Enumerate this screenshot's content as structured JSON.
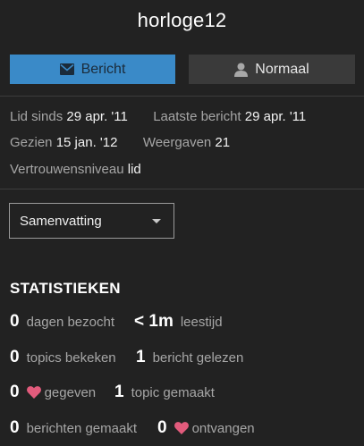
{
  "profile": {
    "username": "horloge12"
  },
  "actions": {
    "message_label": "Bericht",
    "normal_label": "Normaal"
  },
  "meta": {
    "member_since_label": "Lid sinds",
    "member_since_value": "29 apr. '11",
    "last_post_label": "Laatste bericht",
    "last_post_value": "29 apr. '11",
    "seen_label": "Gezien",
    "seen_value": "15 jan. '12",
    "views_label": "Weergaven",
    "views_value": "21",
    "trust_label": "Vertrouwensniveau",
    "trust_value": "lid"
  },
  "summary_select": {
    "selected": "Samenvatting"
  },
  "stats": {
    "title": "STATISTIEKEN",
    "days_visited": {
      "value": "0",
      "label": "dagen bezocht"
    },
    "read_time": {
      "value": "< 1m",
      "label": "leestijd"
    },
    "topics_viewed": {
      "value": "0",
      "label": "topics bekeken"
    },
    "posts_read": {
      "value": "1",
      "label": "bericht gelezen"
    },
    "likes_given": {
      "value": "0",
      "label": "gegeven"
    },
    "topics_created": {
      "value": "1",
      "label": "topic gemaakt"
    },
    "posts_created": {
      "value": "0",
      "label": "berichten gemaakt"
    },
    "likes_received": {
      "value": "0",
      "label": "ontvangen"
    }
  },
  "colors": {
    "background": "#222222",
    "primary_button": "#3a8ac8",
    "secondary_button": "#3a3a3a",
    "heart": "#e25b7c"
  },
  "icons": {
    "message": "envelope-icon",
    "normal": "user-icon",
    "heart": "heart-icon",
    "caret": "caret-down-icon"
  }
}
